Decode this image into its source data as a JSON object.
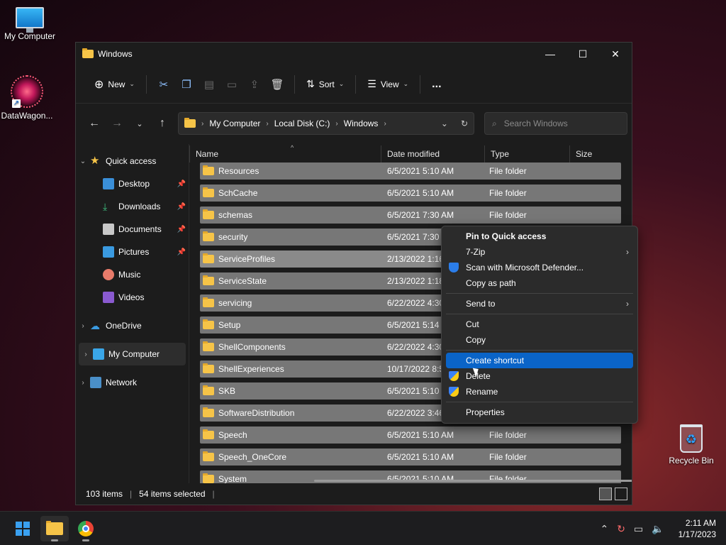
{
  "desktop": {
    "icons": [
      {
        "label": "My Computer"
      },
      {
        "label": "DataWagon..."
      },
      {
        "label": "Recycle Bin"
      }
    ]
  },
  "window": {
    "title": "Windows",
    "toolbar": {
      "new_label": "New",
      "sort_label": "Sort",
      "view_label": "View",
      "more_label": "..."
    },
    "address": {
      "crumbs": [
        "My Computer",
        "Local Disk (C:)",
        "Windows"
      ]
    },
    "search": {
      "placeholder": "Search Windows"
    },
    "sidebar": {
      "quick_access": "Quick access",
      "items": [
        "Desktop",
        "Downloads",
        "Documents",
        "Pictures",
        "Music",
        "Videos"
      ],
      "onedrive": "OneDrive",
      "my_computer": "My Computer",
      "network": "Network"
    },
    "columns": {
      "name": "Name",
      "date": "Date modified",
      "type": "Type",
      "size": "Size"
    },
    "rows": [
      {
        "name": "Resources",
        "date": "6/5/2021 5:10 AM",
        "type": "File folder"
      },
      {
        "name": "SchCache",
        "date": "6/5/2021 5:10 AM",
        "type": "File folder"
      },
      {
        "name": "schemas",
        "date": "6/5/2021 7:30 AM",
        "type": "File folder"
      },
      {
        "name": "security",
        "date": "6/5/2021 7:30 A",
        "type": ""
      },
      {
        "name": "ServiceProfiles",
        "date": "2/13/2022 1:16",
        "type": ""
      },
      {
        "name": "ServiceState",
        "date": "2/13/2022 1:18",
        "type": ""
      },
      {
        "name": "servicing",
        "date": "6/22/2022 4:30",
        "type": ""
      },
      {
        "name": "Setup",
        "date": "6/5/2021 5:14 A",
        "type": ""
      },
      {
        "name": "ShellComponents",
        "date": "6/22/2022 4:30",
        "type": ""
      },
      {
        "name": "ShellExperiences",
        "date": "10/17/2022 8:5",
        "type": ""
      },
      {
        "name": "SKB",
        "date": "6/5/2021 5:10 A",
        "type": ""
      },
      {
        "name": "SoftwareDistribution",
        "date": "6/22/2022 3:46",
        "type": ""
      },
      {
        "name": "Speech",
        "date": "6/5/2021 5:10 AM",
        "type": "File folder"
      },
      {
        "name": "Speech_OneCore",
        "date": "6/5/2021 5:10 AM",
        "type": "File folder"
      },
      {
        "name": "System",
        "date": "6/5/2021 5:10 AM",
        "type": "File folder"
      }
    ],
    "status": {
      "count": "103 items",
      "selected": "54 items selected"
    }
  },
  "context_menu": {
    "pin": "Pin to Quick access",
    "zip": "7-Zip",
    "scan": "Scan with Microsoft Defender...",
    "copy_path": "Copy as path",
    "send_to": "Send to",
    "cut": "Cut",
    "copy": "Copy",
    "create_shortcut": "Create shortcut",
    "delete": "Delete",
    "rename": "Rename",
    "properties": "Properties"
  },
  "taskbar": {
    "time": "2:11 AM",
    "date": "1/17/2023"
  },
  "colors": {
    "accent": "#0a64c8",
    "folder": "#f6c448",
    "selection": "#777777"
  }
}
